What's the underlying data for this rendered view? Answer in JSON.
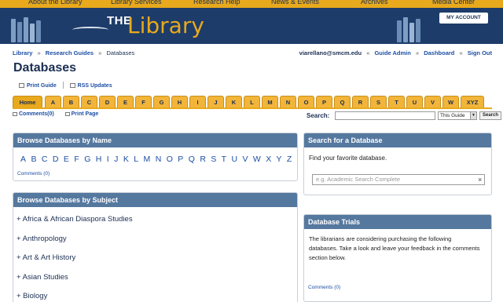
{
  "top_nav": [
    "About the Library",
    "Library Services",
    "Research Help",
    "News & Events",
    "Archives",
    "Media Center"
  ],
  "banner": {
    "logo_the": "THE",
    "logo_library": "Library",
    "my_account": "MY ACCOUNT"
  },
  "breadcrumb": {
    "items": [
      "Library",
      "Research Guides",
      "Databases"
    ]
  },
  "user_bar": {
    "email": "viarellano@smcm.edu",
    "links": [
      "Guide Admin",
      "Dashboard",
      "Sign Out"
    ]
  },
  "page": {
    "title": "Databases",
    "print_guide": "Print Guide",
    "rss": "RSS Updates"
  },
  "tabs": [
    "Home",
    "A",
    "B",
    "C",
    "D",
    "E",
    "F",
    "G",
    "H",
    "I",
    "J",
    "K",
    "L",
    "M",
    "N",
    "O",
    "P",
    "Q",
    "R",
    "S",
    "T",
    "U",
    "V",
    "W",
    "XYZ"
  ],
  "subbar": {
    "comments": "Comments(0)",
    "print_page": "Print Page",
    "search_label": "Search:",
    "scope": "This Guide",
    "search_button": "Search"
  },
  "browse_name": {
    "title": "Browse Databases by Name",
    "letters": [
      "A",
      "B",
      "C",
      "D",
      "E",
      "F",
      "G",
      "H",
      "I",
      "J",
      "K",
      "L",
      "M",
      "N",
      "O",
      "P",
      "Q",
      "R",
      "S",
      "T",
      "U",
      "V",
      "W",
      "X",
      "Y",
      "Z"
    ],
    "comments": "Comments (0)"
  },
  "browse_subject": {
    "title": "Browse Databases by Subject",
    "items": [
      "+ Africa & African Diaspora Studies",
      "+ Anthropology",
      "+ Art & Art History",
      "+ Asian Studies",
      "+ Biology"
    ]
  },
  "search_db": {
    "title": "Search for a Database",
    "text": "Find your favorite database.",
    "placeholder": "e.g. Academic Search Complete",
    "clear": "×"
  },
  "trials": {
    "title": "Database Trials",
    "text": "The librarians are considering purchasing the following databases. Take a look and leave your feedback in the comments section below.",
    "comments": "Comments (0)"
  },
  "colors": {
    "navy": "#1d3c6a",
    "gold": "#e8a91c",
    "box_header": "#55789f",
    "link": "#1d4fa3"
  }
}
